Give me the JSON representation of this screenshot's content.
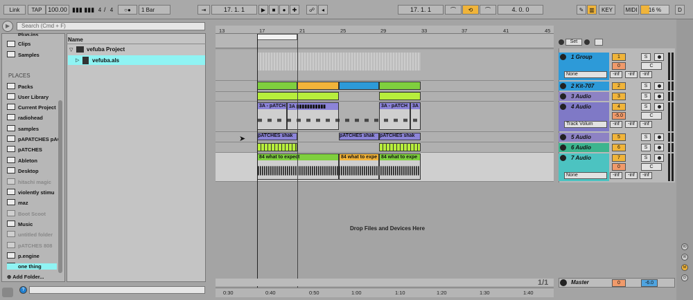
{
  "toolbar": {
    "link": "Link",
    "tap": "TAP",
    "tempo": "100.00",
    "sig_num": "4",
    "sig_den": "4",
    "quantize": "1 Bar",
    "arr_pos": "17.  1.  1",
    "loop_start": "17.  1.  1",
    "loop_len": "4.  0.  0",
    "key": "KEY",
    "midi": "MIDI",
    "cpu": "16 %",
    "d": "D"
  },
  "browser": {
    "search_placeholder": "Search (Cmd + F)",
    "categories": [
      "Plug-ins",
      "Clips",
      "Samples"
    ],
    "places_header": "PLACES",
    "places": [
      "Packs",
      "User Library",
      "Current Project",
      "radiohead",
      "samples",
      "pAPATCHES pAC",
      "pATCHES",
      "Ableton",
      "Desktop",
      "hitachi magic",
      "violently stimu",
      "maz",
      "Boot Scoot",
      "Music",
      "untitled folder",
      "pATCHES 808",
      "p.engine",
      "one thing"
    ],
    "add_folder": "Add Folder...",
    "name_header": "Name",
    "project": "vefuba Project",
    "file": "vefuba.als"
  },
  "ruler": {
    "bars": [
      "13",
      "17",
      "21",
      "25",
      "29",
      "33",
      "37",
      "41",
      "45"
    ],
    "times": [
      "0:30",
      "0:40",
      "0:50",
      "1:00",
      "1:10",
      "1:20",
      "1:30",
      "1:40"
    ]
  },
  "set_label": "Set",
  "tracks": [
    {
      "name": "1 Group",
      "num": "1",
      "color": "#2d9ad8",
      "vol": "0",
      "pan": "C",
      "input": "None"
    },
    {
      "name": "2 Kit-707",
      "num": "2",
      "color": "#2d9ad8"
    },
    {
      "name": "3 Audio",
      "num": "3",
      "color": "#8d82c4"
    },
    {
      "name": "4 Audio",
      "num": "4",
      "color": "#7f79c6",
      "vol": "-5.0",
      "pan": "C",
      "input": "Track Volum"
    },
    {
      "name": "5 Audio",
      "num": "5",
      "color": "#8d82c4"
    },
    {
      "name": "6 Audio",
      "num": "6",
      "color": "#3cb58e"
    },
    {
      "name": "7 Audio",
      "num": "7",
      "color": "#4cc3c1",
      "vol": "0",
      "pan": "C",
      "input": "None"
    }
  ],
  "inf": "-inf",
  "s_label": "S",
  "clips": {
    "a": "3A - pATCH",
    "b": "3A",
    "c": "3A - pATCH",
    "d": "3A",
    "shak1": "pATCHES shak",
    "shak2": "pATCHES shak",
    "shak3": "pATCHES shak",
    "w1": "84 what to expect",
    "w2": "84 what to expe",
    "w3": "84 what to expe"
  },
  "drop_text": "Drop Files and Devices Here",
  "page_indicator": "1/1",
  "master": {
    "name": "Master",
    "vol": "0",
    "pan": "-6.0"
  },
  "right_letters": [
    "IO",
    "R",
    "M",
    "D"
  ]
}
